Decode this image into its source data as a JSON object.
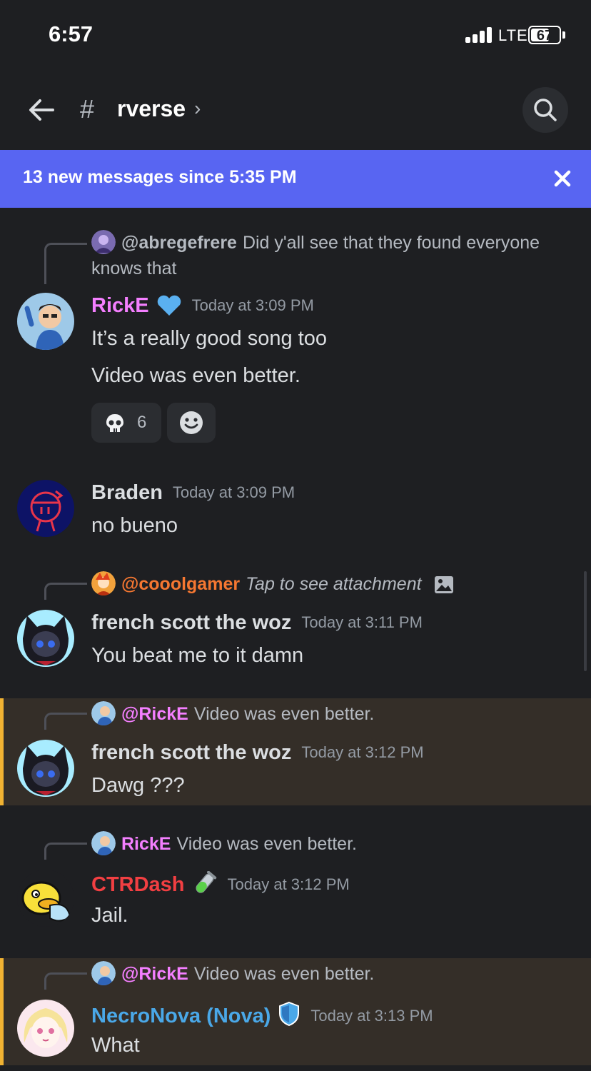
{
  "status_bar": {
    "time": "6:57",
    "network": "LTE",
    "battery": "67",
    "battery_level": 0.67
  },
  "header": {
    "channel_hash": "#",
    "channel_name": "rverse",
    "chevron": "›"
  },
  "banner": {
    "text": "13 new messages since 5:35 PM"
  },
  "messages": [
    {
      "reply_name": "@abregefrere",
      "reply_text": "Did y'all see that they found everyone knows that",
      "author": "RickE",
      "author_color": "#f47fff",
      "timestamp": "Today at 3:09 PM",
      "lines": [
        "It’s a really good song too",
        "Video was even better."
      ],
      "reactions": [
        {
          "emoji": "skull",
          "count": "6"
        },
        {
          "emoji": "add-reaction"
        }
      ]
    },
    {
      "author": "Braden",
      "author_color": "#dbdee1",
      "timestamp": "Today at 3:09 PM",
      "lines": [
        "no bueno"
      ]
    },
    {
      "reply_name": "@cooolgamer",
      "reply_name_color": "#f57731",
      "reply_text": "Tap to see attachment",
      "author": "french scott the woz",
      "author_color": "#dbdee1",
      "timestamp": "Today at 3:11 PM",
      "lines": [
        "You beat me to it damn"
      ]
    },
    {
      "reply_name": "@RickE",
      "reply_name_color": "#f47fff",
      "reply_text": "Video was even better.",
      "author": "french scott the woz",
      "author_color": "#dbdee1",
      "timestamp": "Today at 3:12 PM",
      "lines": [
        "Dawg ???"
      ],
      "highlight": true
    },
    {
      "reply_name": "RickE",
      "reply_name_color": "#f47fff",
      "reply_text": "Video was even better.",
      "author": "CTRDash",
      "author_color": "#f23f42",
      "timestamp": "Today at 3:12 PM",
      "lines": [
        "Jail."
      ]
    },
    {
      "reply_name": "@RickE",
      "reply_name_color": "#f47fff",
      "reply_text": "Video was even better.",
      "author": "NecroNova (Nova)",
      "author_color": "#4aa8e8",
      "timestamp": "Today at 3:13 PM",
      "lines": [
        "What"
      ],
      "highlight": true
    }
  ],
  "icons": {
    "back": "back-arrow-icon",
    "search": "search-icon",
    "close": "close-icon",
    "heart": "blue-heart-icon",
    "test_tube": "test-tube-icon",
    "shield": "shield-icon",
    "image": "image-icon",
    "skull": "skull-icon",
    "smile": "add-reaction-icon"
  }
}
